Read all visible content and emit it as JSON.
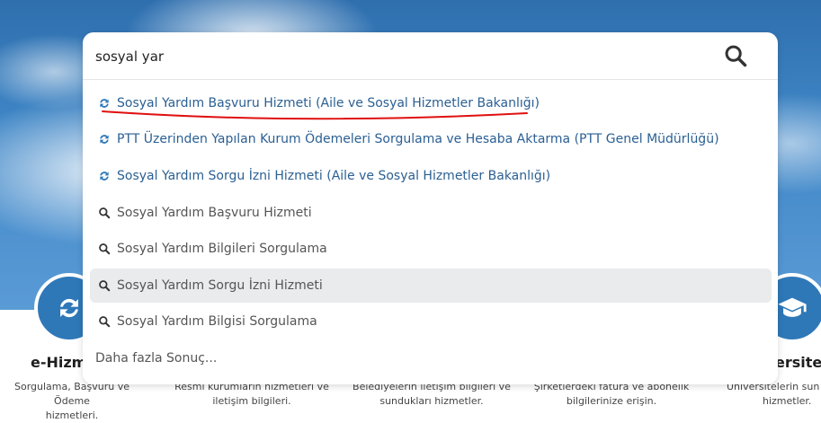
{
  "colors": {
    "accent": "#2e78b8",
    "service_text": "#2a5f93",
    "highlight": "#e9ebed",
    "annotation": "#e01010"
  },
  "search": {
    "value": "sosyal yar",
    "button_icon": "search-icon"
  },
  "suggestions": [
    {
      "type": "service",
      "icon": "refresh-icon",
      "label": "Sosyal Yardım Başvuru Hizmeti (Aile ve Sosyal Hizmetler Bakanlığı)"
    },
    {
      "type": "service",
      "icon": "refresh-icon",
      "label": "PTT Üzerinden Yapılan Kurum Ödemeleri Sorgulama ve Hesaba Aktarma (PTT Genel Müdürlüğü)"
    },
    {
      "type": "service",
      "icon": "refresh-icon",
      "label": "Sosyal Yardım Sorgu İzni Hizmeti (Aile ve Sosyal Hizmetler Bakanlığı)"
    },
    {
      "type": "query",
      "icon": "search-icon",
      "label": "Sosyal Yardım Başvuru Hizmeti"
    },
    {
      "type": "query",
      "icon": "search-icon",
      "label": "Sosyal Yardım Bilgileri Sorgulama"
    },
    {
      "type": "query",
      "icon": "search-icon",
      "label": "Sosyal Yardım Sorgu İzni Hizmeti",
      "highlighted": true
    },
    {
      "type": "query",
      "icon": "search-icon",
      "label": "Sosyal Yardım Bilgisi Sorgulama"
    }
  ],
  "more_results": "Daha fazla Sonuç...",
  "background_cards": {
    "left_title": "e-Hizme",
    "left_desc_1": "Sorgulama, Başvuru ve Ödeme",
    "left_desc_2": "hizmetleri.",
    "desc2_1": "Resmi kurumların hizmetleri ve",
    "desc2_2": "iletişim bilgileri.",
    "desc3_1": "Belediyelerin iletişim bilgileri ve",
    "desc3_2": "sundukları hizmetler.",
    "desc4_1": "Şirketlerdeki fatura ve abonelik",
    "desc4_2": "bilgilerinize erişin.",
    "right_title": "ersitele",
    "right_desc_1": "Üniversitelerin sun",
    "right_desc_2": "hizmetler.",
    "left_icon": "refresh-icon",
    "right_icon": "graduation-cap-icon"
  }
}
